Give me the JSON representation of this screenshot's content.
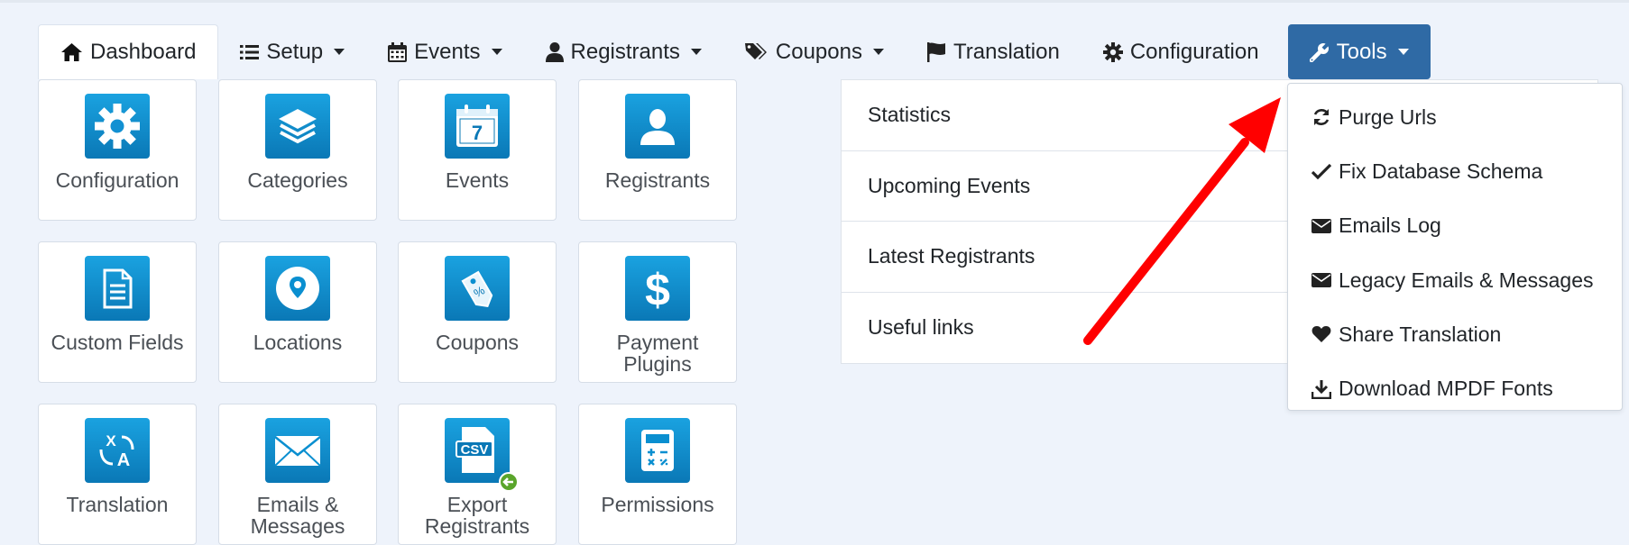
{
  "nav": {
    "tabs": [
      {
        "label": "Dashboard",
        "icon": "home-icon"
      },
      {
        "label": "Setup",
        "icon": "list-icon",
        "dropdown": true
      },
      {
        "label": "Events",
        "icon": "calendar-icon",
        "dropdown": true
      },
      {
        "label": "Registrants",
        "icon": "user-icon",
        "dropdown": true
      },
      {
        "label": "Coupons",
        "icon": "tags-icon",
        "dropdown": true
      },
      {
        "label": "Translation",
        "icon": "flag-icon"
      },
      {
        "label": "Configuration",
        "icon": "gear-icon"
      },
      {
        "label": "Tools",
        "icon": "wrench-icon",
        "dropdown": true
      }
    ]
  },
  "tiles": [
    {
      "label": "Configuration",
      "icon": "gear-icon"
    },
    {
      "label": "Categories",
      "icon": "layers-icon"
    },
    {
      "label": "Events",
      "icon": "calendar-icon",
      "day": "7"
    },
    {
      "label": "Registrants",
      "icon": "user-icon"
    },
    {
      "label": "Custom Fields",
      "icon": "document-icon"
    },
    {
      "label": "Locations",
      "icon": "location-pin-icon"
    },
    {
      "label": "Coupons",
      "icon": "price-tag-icon",
      "tag_text": "%"
    },
    {
      "label": "Payment Plugins",
      "icon": "dollar-icon",
      "symbol": "$"
    },
    {
      "label": "Translation",
      "icon": "translate-icon",
      "glyph_x": "X",
      "glyph_a": "A"
    },
    {
      "label": "Emails & Messages",
      "icon": "envelope-icon"
    },
    {
      "label": "Export Registrants",
      "icon": "csv-export-icon",
      "csv_text": "CSV"
    },
    {
      "label": "Permissions",
      "icon": "calculator-icon"
    }
  ],
  "panel": {
    "items": [
      "Statistics",
      "Upcoming Events",
      "Latest Registrants",
      "Useful links"
    ]
  },
  "tools_menu": {
    "items": [
      {
        "label": "Purge Urls",
        "icon": "refresh-icon"
      },
      {
        "label": "Fix Database Schema",
        "icon": "check-icon"
      },
      {
        "label": "Emails Log",
        "icon": "envelope-icon"
      },
      {
        "label": "Legacy Emails & Messages",
        "icon": "envelope-icon"
      },
      {
        "label": "Share Translation",
        "icon": "heart-icon"
      },
      {
        "label": "Download MPDF Fonts",
        "icon": "download-icon"
      }
    ]
  },
  "colors": {
    "background": "#eef3fb",
    "tools_tab": "#2f6aa5",
    "tile_icon": "#0a8fd0",
    "annotation_arrow": "#ff0000"
  }
}
